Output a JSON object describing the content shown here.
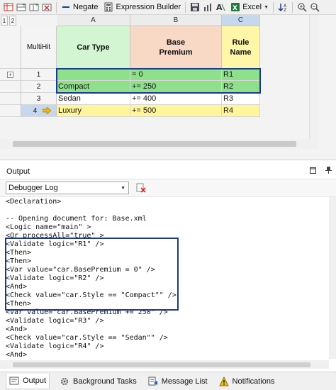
{
  "toolbar": {
    "negate_label": "Negate",
    "expression_builder_label": "Expression Builder",
    "excel_label": "Excel",
    "icons": [
      "table-view-icon",
      "insert-row-icon",
      "insert-column-icon",
      "delete-icon",
      "negate-icon",
      "expression-builder-icon",
      "save-icon",
      "chart-icon",
      "text-format-icon",
      "excel-icon",
      "sort-icon",
      "zoom-in-icon",
      "zoom-out-icon"
    ]
  },
  "grid": {
    "corner_buttons": [
      "1",
      "2"
    ],
    "column_letters": [
      "A",
      "B",
      "C"
    ],
    "multihit_label": "MultiHit",
    "columns": [
      {
        "title": "Car Type",
        "color": "#d3f5d1"
      },
      {
        "title": "Base\nPremium",
        "color": "#f8d9c6"
      },
      {
        "title": "Rule\nName",
        "color": "#fff6a8"
      }
    ],
    "rows": [
      {
        "num": "1",
        "car_type": "",
        "premium": "= 0",
        "rule": "R1",
        "style": "green"
      },
      {
        "num": "2",
        "car_type": "Compact",
        "premium": "+= 250",
        "rule": "R2",
        "style": "green"
      },
      {
        "num": "3",
        "car_type": "Sedan",
        "premium": "+= 400",
        "rule": "R3",
        "style": "white"
      },
      {
        "num": "4",
        "car_type": "Luxury",
        "premium": "+= 500",
        "rule": "R4",
        "style": "yellow"
      }
    ],
    "colors": {
      "highlight_border": "#1c3a8c",
      "green_row": "#8fe08a",
      "yellow_row": "#fff59b"
    }
  },
  "output": {
    "title": "Output",
    "log_selector": "Debugger Log",
    "lines": [
      "<Declaration>",
      "",
      "-- Opening document for: Base.xml",
      "<Logic name=\"main\" >",
      "<Or processAll=\"true\" >",
      "<Validate logic=\"R1\" />",
      "<Then>",
      "<Then>",
      "<Var value=\"car.BasePremium = 0\" />",
      "<Validate logic=\"R2\" />",
      "<And>",
      "<Check value=\"car.Style == \"Compact\"\" />",
      "<Then>",
      "<Var value=\"car.BasePremium += 250\" />",
      "<Validate logic=\"R3\" />",
      "<And>",
      "<Check value=\"car.Style == \"Sedan\"\" />",
      "<Validate logic=\"R4\" />",
      "<And>"
    ]
  },
  "tabs": [
    {
      "label": "Output",
      "icon": "output-icon",
      "active": true
    },
    {
      "label": "Background Tasks",
      "icon": "background-tasks-icon",
      "active": false
    },
    {
      "label": "Message List",
      "icon": "message-list-icon",
      "active": false
    },
    {
      "label": "Notifications",
      "icon": "notifications-icon",
      "active": false
    }
  ]
}
